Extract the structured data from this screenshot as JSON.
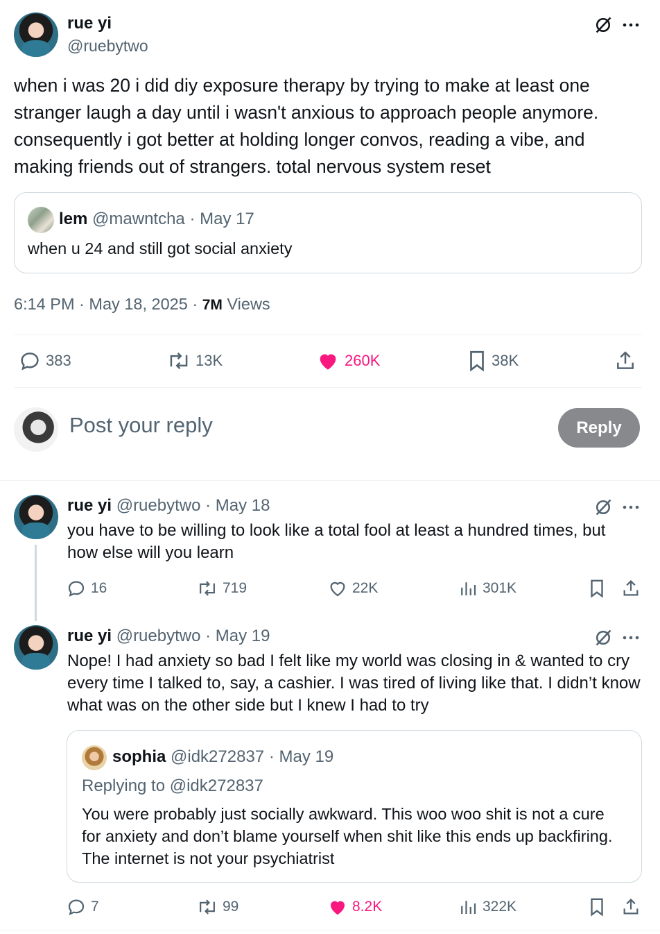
{
  "main_post": {
    "author_name": "rue yi",
    "author_handle": "@ruebytwo",
    "text": "when i was 20 i did diy exposure therapy by trying to make at least one stranger laugh a day until i wasn't anxious to approach people anymore. consequently i got better at holding longer convos, reading a vibe, and making friends out of strangers. total nervous system reset",
    "quoted": {
      "author_name": "lem",
      "author_handle": "@mawntcha",
      "date": "· May 17",
      "text": "when u 24 and still got social anxiety"
    },
    "timestamp": "6:14 PM · May 18, 2025 ·",
    "views_count": "7M",
    "views_label": "Views",
    "stats": {
      "replies": "383",
      "reposts": "13K",
      "likes": "260K",
      "bookmarks": "38K"
    }
  },
  "composer": {
    "placeholder": "Post your reply",
    "button_label": "Reply"
  },
  "replies": [
    {
      "author_name": "rue yi",
      "author_handle": "@ruebytwo",
      "date": "· May 18",
      "text": "you have to be willing to look like a total fool at least a hundred times, but how else will you learn",
      "stats": {
        "replies": "16",
        "reposts": "719",
        "likes": "22K",
        "views": "301K"
      }
    },
    {
      "author_name": "rue yi",
      "author_handle": "@ruebytwo",
      "date": "· May 19",
      "text": "Nope! I had anxiety so bad I felt like my world was closing in & wanted to cry every time I talked to, say, a cashier. I was tired of living like that. I didn’t know what was on the other side but I knew I had to try",
      "quoted": {
        "author_name": "sophia",
        "author_handle": "@idk272837",
        "date": "· May 19",
        "replying_to": "Replying to @idk272837",
        "text": "You were probably just socially awkward. This woo woo shit is not a cure for anxiety and don’t blame yourself when shit like this ends up backfiring. The internet is not your psychiatrist"
      },
      "stats": {
        "replies": "7",
        "reposts": "99",
        "likes": "8.2K",
        "views": "322K"
      }
    }
  ],
  "icons": [
    "grok-icon",
    "more-icon",
    "reply-icon",
    "repost-icon",
    "like-icon",
    "bookmark-icon",
    "share-icon",
    "views-icon"
  ],
  "colors": {
    "like_pink": "#f91880",
    "secondary_gray": "#536471",
    "reply_button_bg": "#87898c"
  }
}
